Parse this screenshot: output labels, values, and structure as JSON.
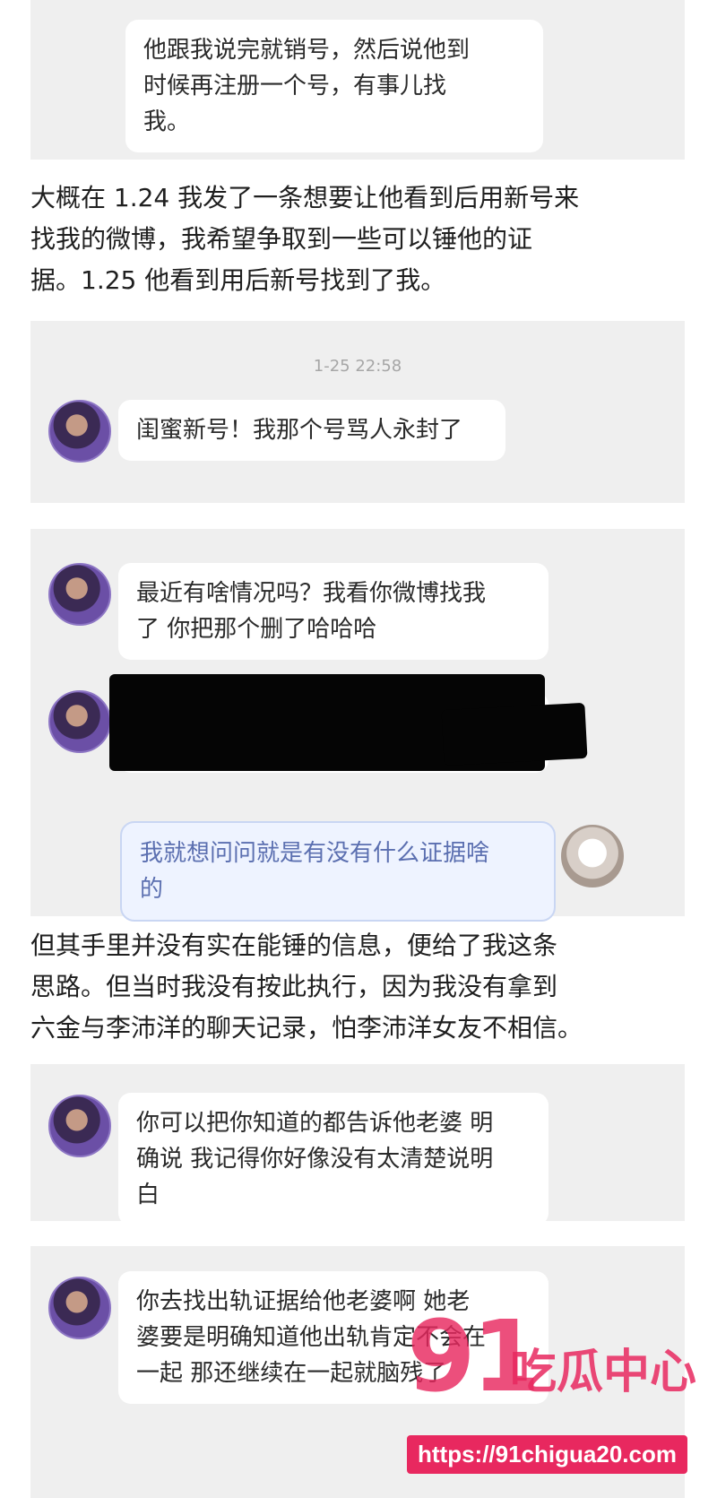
{
  "panel1": {
    "message": "他跟我说完就销号，然后说他到\n时候再注册一个号，有事儿找\n我。"
  },
  "narration1": "大概在 1.24 我发了一条想要让他看到后用新号来\n找我的微博，我希望争取到一些可以锤他的证\n据。1.25 他看到用后新号找到了我。",
  "panel2": {
    "timestamp": "1-25 22:58",
    "message": "闺蜜新号！我那个号骂人永封了"
  },
  "panel3": {
    "message1": "最近有啥情况吗？我看你微博找我\n了 你把那个删了哈哈哈",
    "reply": "我就想问问就是有没有什么证据啥\n的"
  },
  "narration2": "但其手里并没有实在能锤的信息，便给了我这条\n思路。但当时我没有按此执行，因为我没有拿到\n六金与李沛洋的聊天记录，怕李沛洋女友不相信。",
  "panel4": {
    "message": "你可以把你知道的都告诉他老婆 明\n确说 我记得你好像没有太清楚说明\n白"
  },
  "panel5": {
    "message": "你去找出轨证据给他老婆啊 她老\n婆要是明确知道他出轨肯定不会在\n一起 那还继续在一起就脑残了"
  },
  "watermark": {
    "big": "91",
    "cn": "吃瓜中心",
    "url": "https://91chigua20.com"
  },
  "colors": {
    "panel_bg": "#efefef",
    "bubble_bg": "#ffffff",
    "blue_bubble_bg": "#eef3ff",
    "watermark": "#e8285f",
    "green_bubble": "#93e27a"
  },
  "icons": [
    "avatar-left",
    "avatar-right"
  ]
}
